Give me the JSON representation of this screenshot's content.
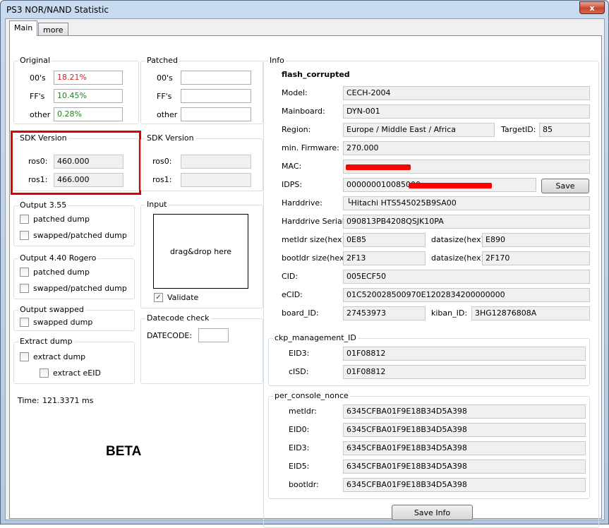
{
  "window": {
    "title": "PS3 NOR/NAND Statistic",
    "close_glyph": "x"
  },
  "tabs": [
    "Main",
    "more"
  ],
  "original": {
    "legend": "Original",
    "rows": [
      {
        "label": "00's",
        "value": "18.21%",
        "color": "#e02020"
      },
      {
        "label": "FF's",
        "value": "10.45%",
        "color": "#208020"
      },
      {
        "label": "other",
        "value": "0.28%",
        "color": "#208020"
      }
    ]
  },
  "patched": {
    "legend": "Patched",
    "rows": [
      {
        "label": "00's",
        "value": ""
      },
      {
        "label": "FF's",
        "value": ""
      },
      {
        "label": "other",
        "value": ""
      }
    ]
  },
  "sdk_original": {
    "legend": "SDK Version",
    "ros0_label": "ros0:",
    "ros0": "460.000",
    "ros1_label": "ros1:",
    "ros1": "466.000"
  },
  "sdk_patched": {
    "legend": "SDK Version",
    "ros0_label": "ros0:",
    "ros0": "",
    "ros1_label": "ros1:",
    "ros1": ""
  },
  "output355": {
    "legend": "Output 3.55",
    "opt1": "patched dump",
    "opt2": "swapped/patched dump"
  },
  "output440": {
    "legend": "Output 4.40 Rogero",
    "opt1": "patched dump",
    "opt2": "swapped/patched dump"
  },
  "output_swapped": {
    "legend": "Output swapped",
    "opt1": "swapped dump"
  },
  "extract": {
    "legend": "Extract dump",
    "opt1": "extract dump",
    "opt2": "extract eEID"
  },
  "input": {
    "legend": "Input",
    "drop_text": "drag&drop here",
    "validate": "Validate",
    "validate_checked": "✓"
  },
  "datecode": {
    "legend": "Datecode check",
    "label": "DATECODE:",
    "value": ""
  },
  "time": {
    "label": "Time:",
    "value": "121.3371 ms"
  },
  "beta": "BETA",
  "info": {
    "legend": "Info",
    "status": "flash_corrupted",
    "model_label": "Model:",
    "model": "CECH-2004",
    "mainboard_label": "Mainboard:",
    "mainboard": "DYN-001",
    "region_label": "Region:",
    "region": "Europe / Middle East / Africa",
    "target_label": "TargetID:",
    "target": "85",
    "fw_label": "min. Firmware:",
    "fw": "270.000",
    "mac_label": "MAC:",
    "mac": "",
    "idps_label": "IDPS:",
    "idps": "000000010085000",
    "save": "Save",
    "hdd_label": "Harddrive:",
    "hdd": "└Hitachi HTS545025B9SA00",
    "hdd_serial_label": "Harddrive Serial:",
    "hdd_serial": "090813PB4208QSJK10PA",
    "metldr_size_label": "metldr size(hex):",
    "metldr_size": "0E85",
    "datasize1_label": "datasize(hex):",
    "datasize1": "E890",
    "bootldr_size_label": "bootldr size(hex):",
    "bootldr_size": "2F13",
    "datasize2_label": "datasize(hex):",
    "datasize2": "2F170",
    "cid_label": "CID:",
    "cid": "005ECF50",
    "ecid_label": "eCID:",
    "ecid": "01C520028500970E1202834200000000",
    "board_label": "board_ID:",
    "board": "27453973",
    "kiban_label": "kiban_ID:",
    "kiban": "3HG12876808A"
  },
  "ckp": {
    "legend": "ckp_management_ID",
    "eid3_label": "EID3:",
    "eid3": "01F08812",
    "cisd_label": "cISD:",
    "cisd": "01F08812"
  },
  "nonce": {
    "legend": "per_console_nonce",
    "rows": [
      {
        "label": "metldr:",
        "value": "6345CFBA01F9E18B34D5A398"
      },
      {
        "label": "EID0:",
        "value": "6345CFBA01F9E18B34D5A398"
      },
      {
        "label": "EID3:",
        "value": "6345CFBA01F9E18B34D5A398"
      },
      {
        "label": "EID5:",
        "value": "6345CFBA01F9E18B34D5A398"
      },
      {
        "label": "bootldr:",
        "value": "6345CFBA01F9E18B34D5A398"
      }
    ]
  },
  "save_info": "Save Info",
  "colors": {
    "highlight": "#e00000",
    "redaction": "#ff0000"
  }
}
